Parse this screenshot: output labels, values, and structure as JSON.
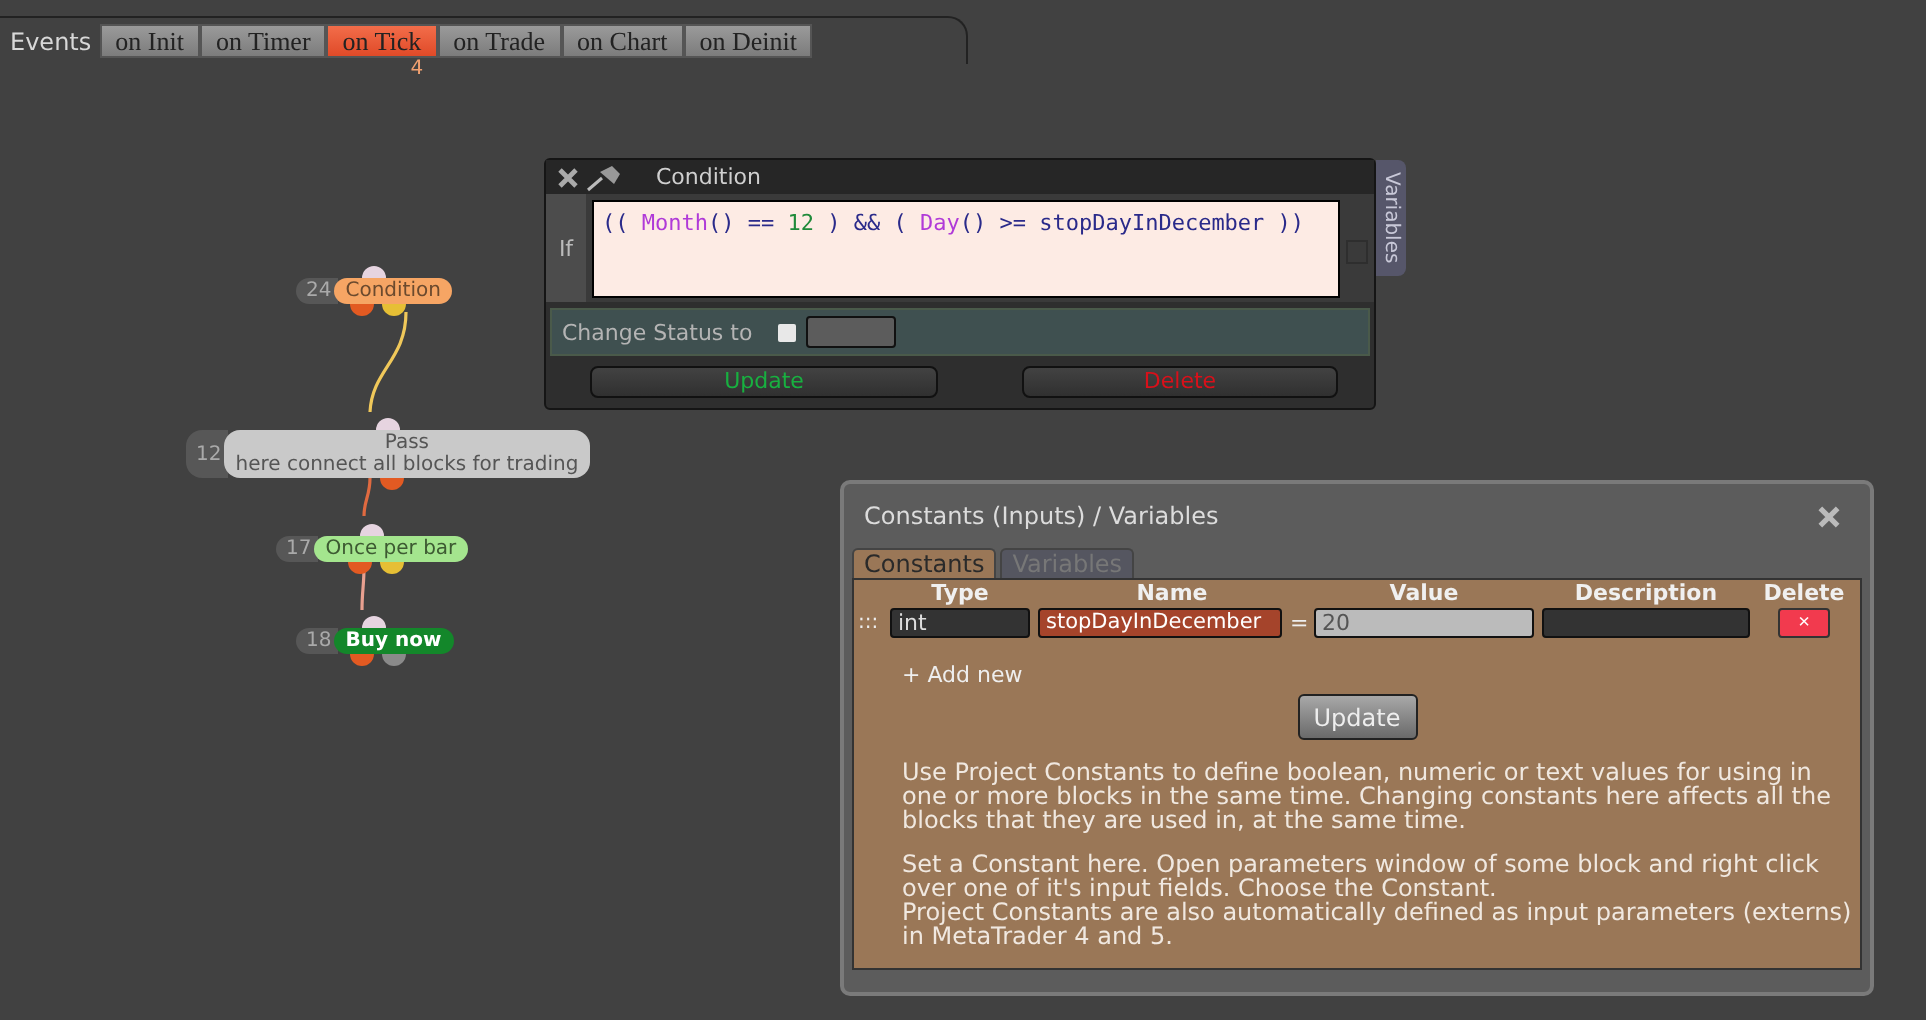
{
  "events_bar": {
    "label": "Events",
    "tabs": [
      {
        "label": "on Init",
        "selected": false
      },
      {
        "label": "on Timer",
        "selected": false
      },
      {
        "label": "on Tick",
        "selected": true,
        "badge": "4"
      },
      {
        "label": "on Trade",
        "selected": false
      },
      {
        "label": "on Chart",
        "selected": false
      },
      {
        "label": "on Deinit",
        "selected": false
      }
    ]
  },
  "nodes": [
    {
      "number": "24",
      "lines": [
        "Condition"
      ],
      "kind": "condition",
      "color": "#f6a564",
      "outputs": [
        {
          "color": "#e25a22"
        },
        {
          "color": "#e6bf35"
        }
      ]
    },
    {
      "number": "12",
      "lines": [
        "Pass",
        "here connect all blocks for trading"
      ],
      "kind": "pass",
      "color": "#c9c9c9",
      "outputs": [
        {
          "color": "#e25a22"
        }
      ]
    },
    {
      "number": "17",
      "lines": [
        "Once per bar"
      ],
      "kind": "once",
      "color": "#a4e58e",
      "outputs": [
        {
          "color": "#e25a22"
        },
        {
          "color": "#e6bf35"
        }
      ]
    },
    {
      "number": "18",
      "lines": [
        "Buy now"
      ],
      "kind": "buy",
      "color": "#13872a",
      "outputs": [
        {
          "color": "#e25a22"
        },
        {
          "color": "#8a8a8a"
        }
      ]
    }
  ],
  "condition_window": {
    "title": "Condition",
    "if_label": "If",
    "code": [
      {
        "text": "(( ",
        "kind": "punct"
      },
      {
        "text": "Month",
        "kind": "func"
      },
      {
        "text": "() == ",
        "kind": "punct"
      },
      {
        "text": "12",
        "kind": "number"
      },
      {
        "text": " ) && ( ",
        "kind": "punct"
      },
      {
        "text": "Day",
        "kind": "func"
      },
      {
        "text": "() >= stopDayInDecember ))",
        "kind": "punct"
      }
    ],
    "change_status_label": "Change Status to",
    "change_status_checked": false,
    "buttons": [
      {
        "label": "Update",
        "kind": "update"
      },
      {
        "label": "Delete",
        "kind": "delete"
      }
    ],
    "side_tab": "Variables"
  },
  "constants_dialog": {
    "title": "Constants (Inputs) / Variables",
    "tabs": [
      {
        "label": "Constants",
        "selected": true
      },
      {
        "label": "Variables",
        "selected": false
      }
    ],
    "columns": [
      "Type",
      "Name",
      "Value",
      "Description",
      "Delete"
    ],
    "rows": [
      {
        "handle": ":::",
        "type": "int",
        "name": "stopDayInDecember",
        "equals": "=",
        "value": "20",
        "delete": "×"
      }
    ],
    "add_new": "+ Add new",
    "update": "Update",
    "paragraphs": [
      "Use Project Constants to define boolean, numeric or text values for using in one or more blocks in the same time. Changing constants here affects all the blocks that they are used in, at the same time.",
      "Set a Constant here. Open parameters window of some block and right click over one of it's input fields. Choose the Constant.\nProject Constants are also automatically defined as input parameters (externs) in MetaTrader 4 and 5."
    ]
  }
}
